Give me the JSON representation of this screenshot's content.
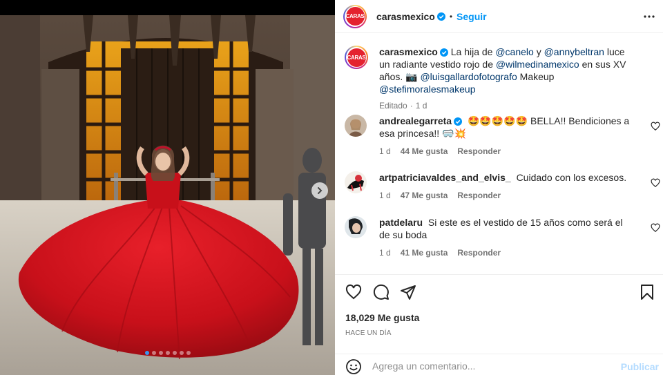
{
  "post": {
    "image_alt": "Mujer con vestido rojo de XV años en un patio de piedra",
    "carousel": {
      "dot_count": 7,
      "active_index": 0
    }
  },
  "header": {
    "avatar_text": "CARAS",
    "username": "carasmexico",
    "separator": "•",
    "follow_label": "Seguir"
  },
  "caption": {
    "username": "carasmexico",
    "segments": [
      {
        "text": "La hija de ",
        "type": "text"
      },
      {
        "text": "@canelo",
        "type": "mention"
      },
      {
        "text": " y ",
        "type": "text"
      },
      {
        "text": "@annybeltran",
        "type": "mention"
      },
      {
        "text": " luce un radiante vestido rojo de ",
        "type": "text"
      },
      {
        "text": "@wilmedinamexico",
        "type": "mention"
      },
      {
        "text": " en sus XV años. ",
        "type": "text"
      },
      {
        "text": "📷 ",
        "type": "text"
      },
      {
        "text": "@luisgallardofotografo",
        "type": "mention"
      },
      {
        "text": " Makeup ",
        "type": "text"
      },
      {
        "text": "@stefimoralesmakeup",
        "type": "mention"
      }
    ],
    "edited": "Editado",
    "dot": "·",
    "time": "1 d"
  },
  "comments": [
    {
      "username": "andrealegarreta",
      "verified": true,
      "text": "🤩🤩🤩🤩🤩 BELLA!! Bendiciones a esa princesa!! 🥽💥",
      "time": "1 d",
      "likes": "44 Me gusta",
      "reply": "Responder"
    },
    {
      "username": "artpatriciavaldes_and_elvis_",
      "verified": false,
      "text": "Cuidado con los excesos.",
      "time": "1 d",
      "likes": "47 Me gusta",
      "reply": "Responder"
    },
    {
      "username": "patdelaru",
      "verified": false,
      "text": "Si este es el vestido de 15 años como será el de su boda",
      "time": "1 d",
      "likes": "41 Me gusta",
      "reply": "Responder"
    }
  ],
  "stats": {
    "likes": "18,029 Me gusta",
    "posted": "HACE UN DÍA"
  },
  "add_comment": {
    "placeholder": "Agrega un comentario...",
    "publish_label": "Publicar"
  },
  "colors": {
    "accent": "#0095f6",
    "mention": "#00376b",
    "brand_red": "#e4222f",
    "dress_red": "#d4141c",
    "muted": "#737373"
  },
  "icons": [
    "more-icon",
    "verified-icon",
    "heart-icon",
    "comment-icon",
    "share-icon",
    "bookmark-icon",
    "emoji-icon",
    "chevron-right-icon"
  ]
}
